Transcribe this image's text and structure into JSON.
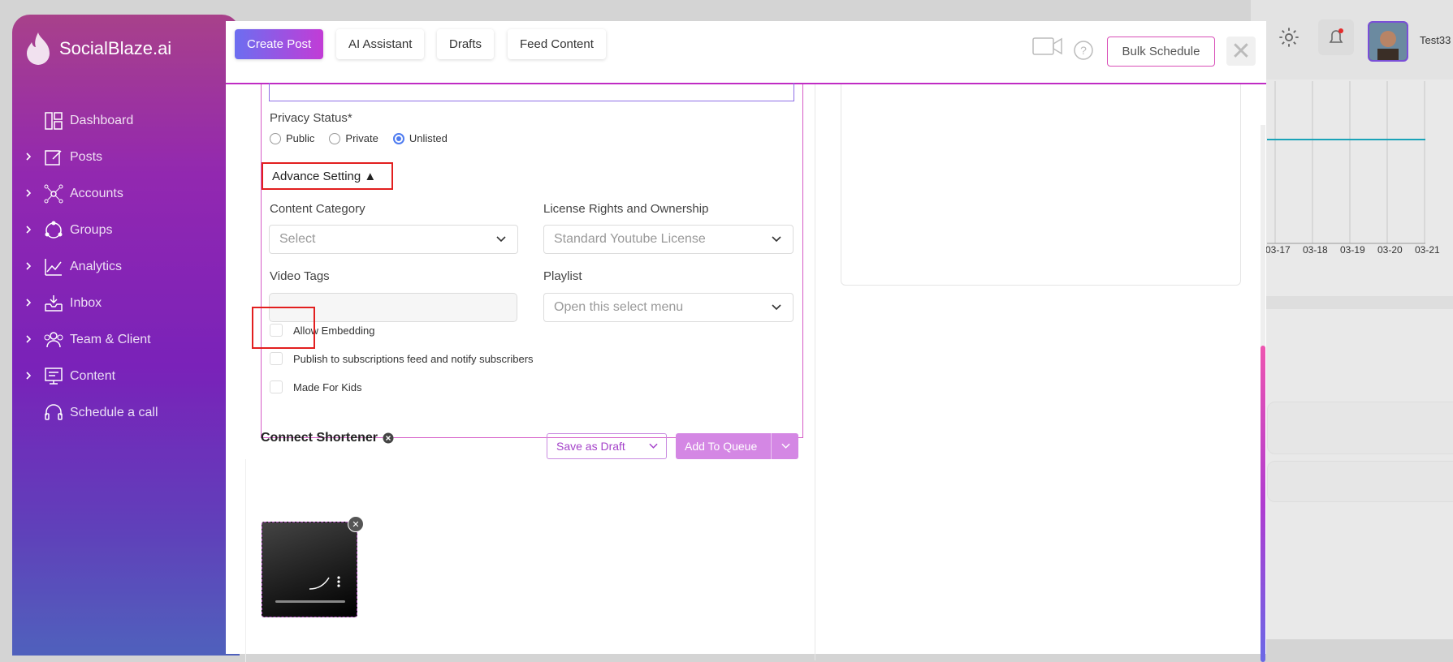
{
  "brand": {
    "name": "SocialBlaze.ai"
  },
  "sidebar": {
    "items": [
      {
        "label": "Dashboard",
        "icon": "dashboard-icon",
        "expandable": false
      },
      {
        "label": "Posts",
        "icon": "edit-icon",
        "expandable": true
      },
      {
        "label": "Accounts",
        "icon": "network-icon",
        "expandable": true
      },
      {
        "label": "Groups",
        "icon": "groups-icon",
        "expandable": true
      },
      {
        "label": "Analytics",
        "icon": "analytics-icon",
        "expandable": true
      },
      {
        "label": "Inbox",
        "icon": "inbox-icon",
        "expandable": true
      },
      {
        "label": "Team & Client",
        "icon": "team-icon",
        "expandable": true
      },
      {
        "label": "Content",
        "icon": "content-icon",
        "expandable": true
      },
      {
        "label": "Schedule a call",
        "icon": "headset-icon",
        "expandable": false
      }
    ]
  },
  "header": {
    "tabs": [
      "Create Post",
      "AI Assistant",
      "Drafts",
      "Feed Content"
    ],
    "active_tab": "Create Post",
    "bulk_schedule": "Bulk Schedule",
    "user_name": "Test33"
  },
  "form": {
    "privacy_label": "Privacy Status*",
    "privacy_options": [
      "Public",
      "Private",
      "Unlisted"
    ],
    "privacy_selected": "Unlisted",
    "advance_setting": "Advance Setting ▲",
    "content_category_label": "Content Category",
    "content_category_value": "Select",
    "license_label": "License Rights and Ownership",
    "license_value": "Standard Youtube License",
    "video_tags_label": "Video Tags",
    "video_tags_value": "",
    "playlist_label": "Playlist",
    "playlist_value": "Open this select menu",
    "checkboxes": [
      "Allow Embedding",
      "Publish to subscriptions feed and notify subscribers",
      "Made For Kids"
    ]
  },
  "actions": {
    "connect_shortener": "Connect Shortener",
    "save_draft": "Save as Draft",
    "add_queue": "Add To Queue"
  },
  "background_chart": {
    "x_labels": [
      "03-17",
      "03-18",
      "03-19",
      "03-20",
      "03-21"
    ],
    "line_color": "#1aa3b8"
  },
  "colors": {
    "accent_pink": "#c02cc4",
    "accent_purple": "#8b27d3",
    "highlight_red": "#e21f1f"
  }
}
